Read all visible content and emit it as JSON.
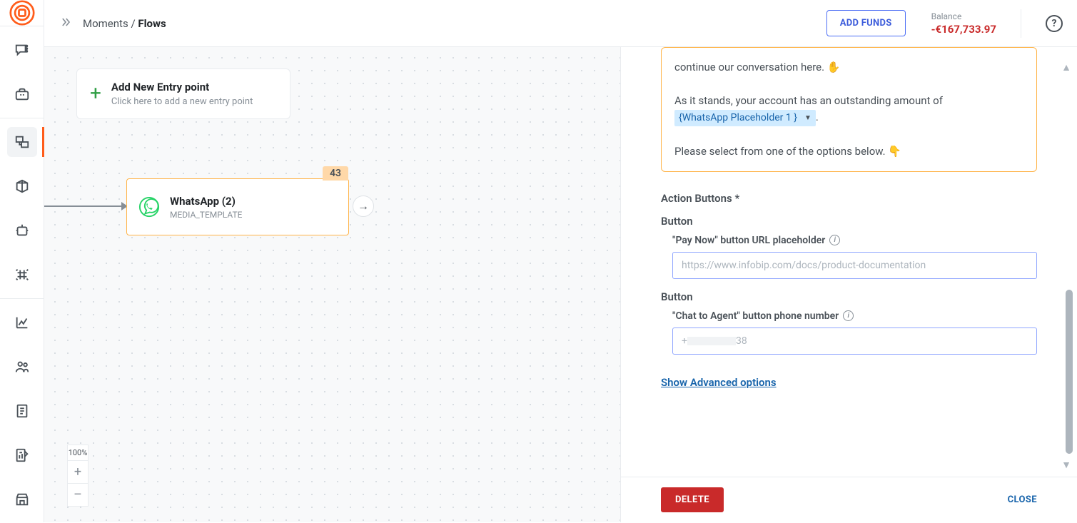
{
  "breadcrumb": {
    "parent": "Moments",
    "current": "Flows"
  },
  "topbar": {
    "add_funds_label": "ADD FUNDS",
    "balance_label": "Balance",
    "balance_value": "-€167,733.97"
  },
  "canvas": {
    "entry": {
      "title": "Add New Entry point",
      "subtitle": "Click here to add a new entry point"
    },
    "whatsapp_node": {
      "title": "WhatsApp (2)",
      "subtitle": "MEDIA_TEMPLATE",
      "badge": "43"
    },
    "zoom": {
      "percent": "100%",
      "plus": "+",
      "minus": "–"
    }
  },
  "panel": {
    "message": {
      "truncated_line": "continue our conversation here. ✋",
      "line2_prefix": "As it stands, your account has an outstanding amount of ",
      "placeholder_token": "{WhatsApp Placeholder 1 }",
      "line2_suffix": ".",
      "line3": "Please select from one of the options below. 👇"
    },
    "action_buttons_label": "Action Buttons *",
    "button_label": "Button",
    "pay_now": {
      "label": "\"Pay Now\" button URL placeholder",
      "placeholder": "https://www.infobip.com/docs/product-documentation"
    },
    "chat_agent": {
      "label": "\"Chat to Agent\" button phone number",
      "value_prefix": "+",
      "value_suffix": "38"
    },
    "advanced_link": "Show Advanced options",
    "footer": {
      "delete": "DELETE",
      "close": "CLOSE"
    }
  }
}
